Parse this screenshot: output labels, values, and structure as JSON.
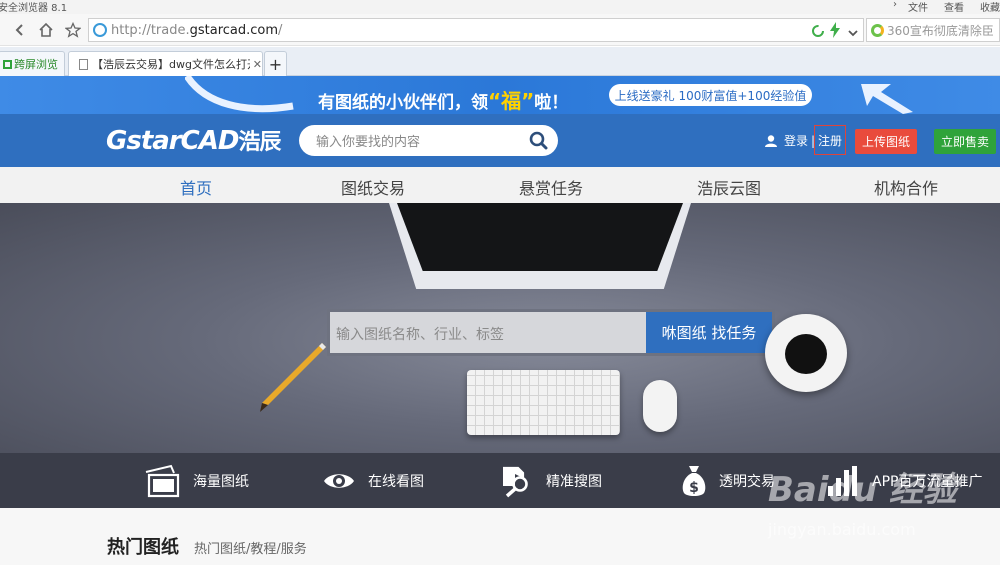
{
  "browser": {
    "title": "安全浏览器 8.1",
    "menu": [
      "文件",
      "查看",
      "收藏"
    ],
    "url_prefix": "http://trade.",
    "url_domain": "gstarcad.com",
    "url_suffix": "/",
    "search_placeholder": "360宣布彻底清除臣",
    "tabs": [
      {
        "label": "跨屏浏览"
      },
      {
        "label": "【浩辰云交易】dwg文件怎么打开"
      }
    ],
    "new_tab": "+"
  },
  "promo": {
    "headline_pre": "有图纸的小伙伴们，领",
    "headline_highlight": "“福”",
    "headline_post": "啦！",
    "pill": "上线送豪礼  100财富值+100经验值"
  },
  "header": {
    "logo_en": "GstarCAD",
    "logo_cn": "浩辰",
    "search_placeholder": "输入你要找的内容",
    "login": "登录",
    "register": "注册",
    "upload": "上传图纸",
    "sell": "立即售卖"
  },
  "nav": {
    "items": [
      {
        "label": "首页",
        "active": true
      },
      {
        "label": "图纸交易",
        "active": false
      },
      {
        "label": "悬赏任务",
        "active": false
      },
      {
        "label": "浩辰云图",
        "active": false
      },
      {
        "label": "机构合作",
        "active": false
      }
    ]
  },
  "hero": {
    "search_placeholder": "输入图纸名称、行业、标签",
    "search_button": "咻图纸  找任务"
  },
  "features": [
    {
      "label": "海量图纸",
      "icon": "image-stack-icon"
    },
    {
      "label": "在线看图",
      "icon": "eye-icon"
    },
    {
      "label": "精准搜图",
      "icon": "search-file-icon"
    },
    {
      "label": "透明交易",
      "icon": "money-bag-icon"
    },
    {
      "label": "APP百万流量推广",
      "icon": "bar-chart-icon"
    }
  ],
  "hot": {
    "title": "热门图纸",
    "subtitle": "热门图纸/教程/服务"
  },
  "watermark": {
    "brand": "Baidu 经验",
    "url": "jingyan.baidu.com"
  },
  "colors": {
    "brand_blue": "#2f6fbf",
    "promo_blue": "#3f8be6",
    "upload_red": "#e94b3c",
    "sell_green": "#2fa33a",
    "feature_bar": "#3a3d49"
  }
}
